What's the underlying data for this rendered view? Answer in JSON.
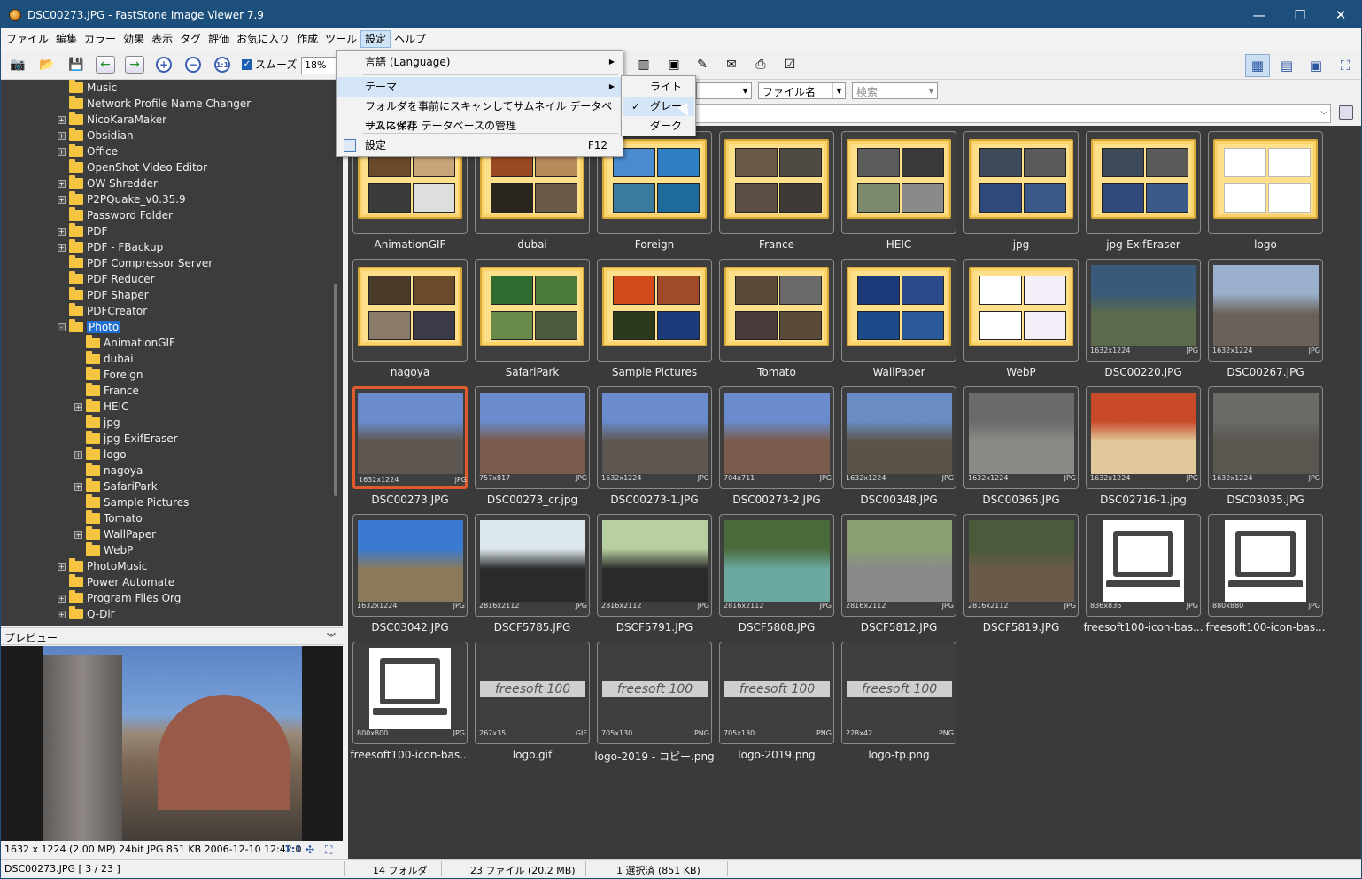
{
  "window": {
    "title": "DSC00273.JPG  -  FastStone Image Viewer 7.9",
    "minimize": "—",
    "maximize": "☐",
    "close": "✕"
  },
  "menu": [
    "ファイル",
    "編集",
    "カラー",
    "効果",
    "表示",
    "タグ",
    "評価",
    "お気に入り",
    "作成",
    "ツール",
    "設定",
    "ヘルプ"
  ],
  "menu_active_index": 10,
  "toolbar": {
    "smooth_label": "スムーズ",
    "smooth_checked": true,
    "zoom": "18%"
  },
  "filter": {
    "sort": "ファイル名",
    "search_placeholder": "検索"
  },
  "tree": [
    {
      "label": "Music",
      "level": 1,
      "expander": ""
    },
    {
      "label": "Network Profile Name Changer",
      "level": 1,
      "expander": ""
    },
    {
      "label": "NicoKaraMaker",
      "level": 1,
      "expander": "+"
    },
    {
      "label": "Obsidian",
      "level": 1,
      "expander": "+"
    },
    {
      "label": "Office",
      "level": 1,
      "expander": "+"
    },
    {
      "label": "OpenShot Video Editor",
      "level": 1,
      "expander": ""
    },
    {
      "label": "OW Shredder",
      "level": 1,
      "expander": "+"
    },
    {
      "label": "P2PQuake_v0.35.9",
      "level": 1,
      "expander": "+"
    },
    {
      "label": "Password Folder",
      "level": 1,
      "expander": ""
    },
    {
      "label": "PDF",
      "level": 1,
      "expander": "+"
    },
    {
      "label": "PDF - FBackup",
      "level": 1,
      "expander": "+"
    },
    {
      "label": "PDF Compressor Server",
      "level": 1,
      "expander": ""
    },
    {
      "label": "PDF Reducer",
      "level": 1,
      "expander": ""
    },
    {
      "label": "PDF Shaper",
      "level": 1,
      "expander": ""
    },
    {
      "label": "PDFCreator",
      "level": 1,
      "expander": ""
    },
    {
      "label": "Photo",
      "level": 1,
      "expander": "−",
      "selected": true
    },
    {
      "label": "AnimationGIF",
      "level": 2,
      "expander": ""
    },
    {
      "label": "dubai",
      "level": 2,
      "expander": ""
    },
    {
      "label": "Foreign",
      "level": 2,
      "expander": ""
    },
    {
      "label": "France",
      "level": 2,
      "expander": ""
    },
    {
      "label": "HEIC",
      "level": 2,
      "expander": "+"
    },
    {
      "label": "jpg",
      "level": 2,
      "expander": ""
    },
    {
      "label": "jpg-ExifEraser",
      "level": 2,
      "expander": ""
    },
    {
      "label": "logo",
      "level": 2,
      "expander": "+"
    },
    {
      "label": "nagoya",
      "level": 2,
      "expander": ""
    },
    {
      "label": "SafariPark",
      "level": 2,
      "expander": "+"
    },
    {
      "label": "Sample Pictures",
      "level": 2,
      "expander": ""
    },
    {
      "label": "Tomato",
      "level": 2,
      "expander": ""
    },
    {
      "label": "WallPaper",
      "level": 2,
      "expander": "+"
    },
    {
      "label": "WebP",
      "level": 2,
      "expander": ""
    },
    {
      "label": "PhotoMusic",
      "level": 1,
      "expander": "+"
    },
    {
      "label": "Power Automate",
      "level": 1,
      "expander": ""
    },
    {
      "label": "Program Files Org",
      "level": 1,
      "expander": "+"
    },
    {
      "label": "Q-Dir",
      "level": 1,
      "expander": "+"
    }
  ],
  "preview": {
    "header": "プレビュー",
    "info": "1632 x 1224 (2.00 MP)  24bit  JPG   851 KB   2006-12-10 12:42:0",
    "ratio": "1:1"
  },
  "thumbnails": [
    {
      "name": "AnimationGIF",
      "kind": "folder",
      "colors": [
        "#6b4a2c",
        "#c9a57a",
        "#3b3b3b",
        "#dedede"
      ]
    },
    {
      "name": "dubai",
      "kind": "folder",
      "colors": [
        "#9a4a22",
        "#b88a5a",
        "#2b2520",
        "#6a5a4a"
      ]
    },
    {
      "name": "Foreign",
      "kind": "folder",
      "colors": [
        "#4a8ad0",
        "#2f7fc4",
        "#3a7b9e",
        "#1e6a9c"
      ]
    },
    {
      "name": "France",
      "kind": "folder",
      "colors": [
        "#6a5a45",
        "#4e4a44",
        "#5a4e42",
        "#3e3a35"
      ]
    },
    {
      "name": "HEIC",
      "kind": "folder",
      "colors": [
        "#5b5b5b",
        "#3a3a3a",
        "#7a8a6a",
        "#8a8a8a"
      ]
    },
    {
      "name": "jpg",
      "kind": "folder",
      "colors": [
        "#3d4a5a",
        "#5a5a5a",
        "#2f4a7a",
        "#3a5a8a"
      ]
    },
    {
      "name": "jpg-ExifEraser",
      "kind": "folder",
      "colors": [
        "#3d4a5a",
        "#5a5a5a",
        "#2f4a7a",
        "#3a5a8a"
      ]
    },
    {
      "name": "logo",
      "kind": "logo",
      "colors": [
        "#ffffff",
        "#ffffff",
        "#ffffff",
        "#ffffff"
      ]
    },
    {
      "name": "nagoya",
      "kind": "folder",
      "colors": [
        "#4a3a2a",
        "#6a4a2a",
        "#8a7a6a",
        "#3a3a4a"
      ]
    },
    {
      "name": "SafariPark",
      "kind": "folder",
      "colors": [
        "#2f6a2f",
        "#4a7a3a",
        "#6a8a4a",
        "#4a5a3a"
      ]
    },
    {
      "name": "Sample Pictures",
      "kind": "folder",
      "colors": [
        "#d04a1a",
        "#a04a2a",
        "#2a3a1a",
        "#1a3a7a"
      ]
    },
    {
      "name": "Tomato",
      "kind": "folder",
      "colors": [
        "#5a4a3a",
        "#6a6a6a",
        "#4a3a3a",
        "#5a4a3a"
      ]
    },
    {
      "name": "WallPaper",
      "kind": "folder",
      "colors": [
        "#1a3a7a",
        "#2a4a8a",
        "#1a4a8a",
        "#2a5a9a"
      ]
    },
    {
      "name": "WebP",
      "kind": "folder",
      "colors": [
        "#ffffff",
        "#f4eef8",
        "#ffffff",
        "#f4eef8"
      ]
    },
    {
      "name": "DSC00220.JPG",
      "kind": "photo",
      "dims": "1632x1224",
      "fmt": "JPG",
      "colors": [
        "#3a5a7a",
        "#5a6a4a"
      ]
    },
    {
      "name": "DSC00267.JPG",
      "kind": "photo",
      "dims": "1632x1224",
      "fmt": "JPG",
      "colors": [
        "#9ab0cc",
        "#6a625a"
      ]
    },
    {
      "name": "DSC00273.JPG",
      "kind": "photo",
      "dims": "1632x1224",
      "fmt": "JPG",
      "selected": true,
      "colors": [
        "#6a8ccc",
        "#5e5650"
      ]
    },
    {
      "name": "DSC00273_cr.jpg",
      "kind": "photo",
      "dims": "757x817",
      "fmt": "JPG",
      "colors": [
        "#6a8ccc",
        "#7a5a4a"
      ]
    },
    {
      "name": "DSC00273-1.JPG",
      "kind": "photo",
      "dims": "1632x1224",
      "fmt": "JPG",
      "colors": [
        "#6a8ccc",
        "#5e5650"
      ]
    },
    {
      "name": "DSC00273-2.JPG",
      "kind": "photo",
      "dims": "704x711",
      "fmt": "JPG",
      "colors": [
        "#6a8ccc",
        "#7a5a4a"
      ]
    },
    {
      "name": "DSC00348.JPG",
      "kind": "photo",
      "dims": "1632x1224",
      "fmt": "JPG",
      "colors": [
        "#6a8cc4",
        "#5a5448"
      ]
    },
    {
      "name": "DSC00365.JPG",
      "kind": "photo",
      "dims": "1632x1224",
      "fmt": "JPG",
      "colors": [
        "#6a6a6a",
        "#8a8a86"
      ]
    },
    {
      "name": "DSC02716-1.jpg",
      "kind": "photo",
      "dims": "1632x1224",
      "fmt": "JPG",
      "colors": [
        "#c84a2a",
        "#e0c89a"
      ]
    },
    {
      "name": "DSC03035.JPG",
      "kind": "photo",
      "dims": "1632x1224",
      "fmt": "JPG",
      "colors": [
        "#6a6a66",
        "#5a5650"
      ]
    },
    {
      "name": "DSC03042.JPG",
      "kind": "photo",
      "dims": "1632x1224",
      "fmt": "JPG",
      "colors": [
        "#3a7ad0",
        "#8a7a5a"
      ]
    },
    {
      "name": "DSCF5785.JPG",
      "kind": "photo",
      "dims": "2816x2112",
      "fmt": "JPG",
      "colors": [
        "#dde8ee",
        "#2a2a2a"
      ]
    },
    {
      "name": "DSCF5791.JPG",
      "kind": "photo",
      "dims": "2816x2112",
      "fmt": "JPG",
      "colors": [
        "#b8d0a0",
        "#2a2a2a"
      ]
    },
    {
      "name": "DSCF5808.JPG",
      "kind": "photo",
      "dims": "2816x2112",
      "fmt": "JPG",
      "colors": [
        "#4a6a3a",
        "#6aa8a0"
      ]
    },
    {
      "name": "DSCF5812.JPG",
      "kind": "photo",
      "dims": "2816x2112",
      "fmt": "JPG",
      "colors": [
        "#8aa070",
        "#8a8a8a"
      ]
    },
    {
      "name": "DSCF5819.JPG",
      "kind": "photo",
      "dims": "2816x2112",
      "fmt": "JPG",
      "colors": [
        "#4a5a3a",
        "#6a5a4a"
      ]
    },
    {
      "name": "freesoft100-icon-bas...",
      "kind": "icon",
      "dims": "836x836",
      "fmt": "JPG",
      "colors": [
        "#ffffff",
        "#ffffff"
      ]
    },
    {
      "name": "freesoft100-icon-bas...",
      "kind": "icon",
      "dims": "880x880",
      "fmt": "JPG",
      "colors": [
        "#ffffff",
        "#ffffff"
      ]
    },
    {
      "name": "freesoft100-icon-bas...",
      "kind": "icon",
      "dims": "800x800",
      "fmt": "JPG",
      "colors": [
        "#ffffff",
        "#ffffff"
      ]
    },
    {
      "name": "logo.gif",
      "kind": "banner",
      "dims": "267x35",
      "fmt": "GIF",
      "text": "freesoft 100",
      "colors": [
        "#3e3e3e",
        "#3e3e3e"
      ]
    },
    {
      "name": "logo-2019 - コピー.png",
      "kind": "banner",
      "dims": "705x130",
      "fmt": "PNG",
      "text": "freesoft 100",
      "colors": [
        "#3e3e3e",
        "#3e3e3e"
      ]
    },
    {
      "name": "logo-2019.png",
      "kind": "banner",
      "dims": "705x130",
      "fmt": "PNG",
      "text": "freesoft 100",
      "colors": [
        "#3e3e3e",
        "#3e3e3e"
      ]
    },
    {
      "name": "logo-tp.png",
      "kind": "banner",
      "dims": "228x42",
      "fmt": "PNG",
      "text": "freesoft 100",
      "colors": [
        "#3e3e3e",
        "#3e3e3e"
      ]
    }
  ],
  "status": {
    "file": "DSC00273.JPG [ 3 / 23 ]",
    "folders": "14 フォルダ",
    "files": "23 ファイル (20.2 MB)",
    "selected": "1 選択済 (851 KB)"
  },
  "settings_menu": {
    "items": [
      {
        "label": "言語 (Language)",
        "submenu": true
      },
      {
        "label": "テーマ",
        "submenu": true,
        "highlighted": true
      },
      {
        "label": "フォルダを事前にスキャンしてサムネイル データベースに保存"
      },
      {
        "label": "サムネイル データベースの管理"
      },
      {
        "label": "設定",
        "shortcut": "F12",
        "icon": "settings-icon"
      }
    ]
  },
  "theme_menu": {
    "items": [
      {
        "label": "ライト"
      },
      {
        "label": "グレー",
        "checked": true,
        "highlighted": true
      },
      {
        "label": "ダーク"
      }
    ]
  }
}
